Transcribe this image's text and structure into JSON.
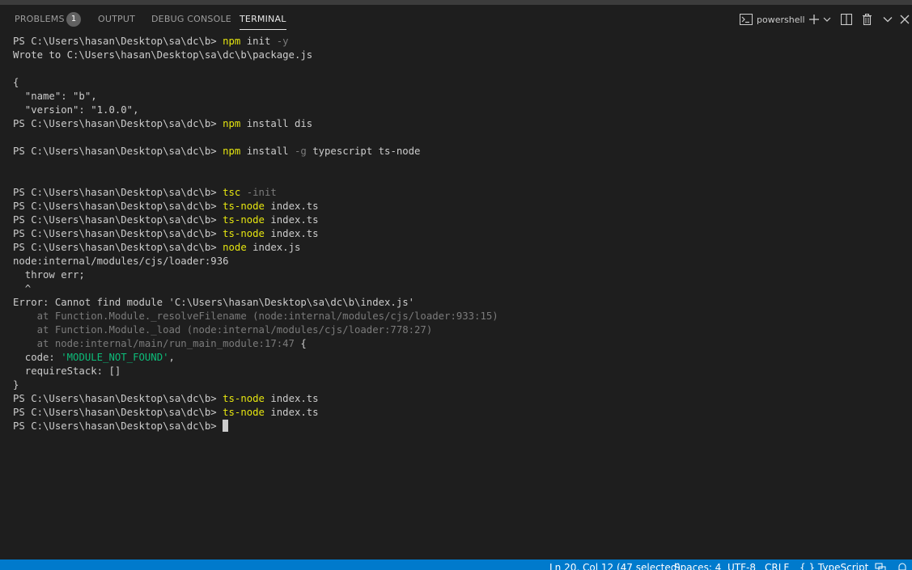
{
  "panel": {
    "tabs": [
      {
        "label": "PROBLEMS",
        "badge": "1"
      },
      {
        "label": "OUTPUT"
      },
      {
        "label": "DEBUG CONSOLE"
      },
      {
        "label": "TERMINAL"
      }
    ],
    "shell_label": "powershell",
    "toolbar_icons": [
      "terminal-icon",
      "plus-icon",
      "chevron-down-icon",
      "split-icon",
      "trash-icon",
      "chevron-down-icon",
      "close-icon"
    ]
  },
  "colors": {
    "background": "#1e1e1e",
    "command": "#e5e510",
    "dim": "#7b7b7b",
    "string": "#0dbc79",
    "statusbar": "#007acc"
  },
  "terminal": {
    "prompt": "PS C:\\Users\\hasan\\Desktop\\sa\\dc\\b> ",
    "lines": {
      "l1_cmd": "npm",
      "l1_args": " init ",
      "l1_flag": "-y",
      "l2": "Wrote to C:\\Users\\hasan\\Desktop\\sa\\dc\\b\\package.js",
      "l3": "{",
      "l4": "  \"name\": \"b\",",
      "l5": "  \"version\": \"1.0.0\",",
      "l6_cmd": "npm",
      "l6_args": " install dis",
      "l7_cmd": "npm",
      "l7_args1": " install ",
      "l7_flag": "-g",
      "l7_args2": " typescript ts-node",
      "l8_cmd": "tsc",
      "l8_args": " ",
      "l8_flag": "-init",
      "l9_cmd": "ts-node",
      "l9_args": " index.ts",
      "l10_cmd": "ts-node",
      "l10_args": " index.ts",
      "l11_cmd": "ts-node",
      "l11_args": " index.ts",
      "l12_cmd": "node",
      "l12_args": " index.js",
      "l13": "node:internal/modules/cjs/loader:936",
      "l14": "  throw err;",
      "l15": "  ^",
      "l16": "Error: Cannot find module 'C:\\Users\\hasan\\Desktop\\sa\\dc\\b\\index.js'",
      "l17": "    at Function.Module._resolveFilename (node:internal/modules/cjs/loader:933:15)",
      "l18": "    at Function.Module._load (node:internal/modules/cjs/loader:778:27)",
      "l19": "    at node:internal/main/run_main_module:17:47",
      "l19_tail": " {",
      "l20_a": "  code: ",
      "l20_str": "'MODULE_NOT_FOUND'",
      "l20_b": ",",
      "l21": "  requireStack: []",
      "l22": "}",
      "l23_cmd": "ts-node",
      "l23_args": " index.ts",
      "l24_cmd": "ts-node",
      "l24_args": " index.ts"
    }
  },
  "statusbar": {
    "position": "Ln 20, Col 12 (47 selected)",
    "spaces": "Spaces: 4",
    "encoding": "UTF-8",
    "eol": "CRLF",
    "language_prefix": "{ }",
    "language": "TypeScript"
  }
}
